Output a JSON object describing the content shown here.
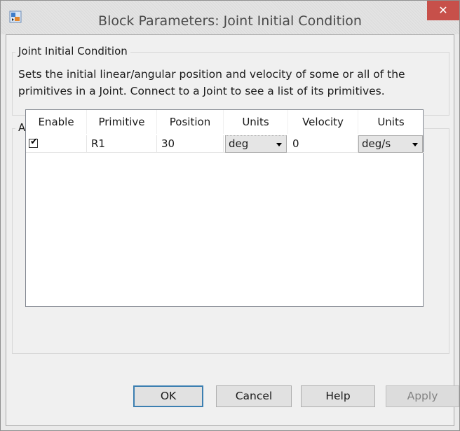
{
  "window": {
    "title": "Block Parameters: Joint Initial Condition",
    "close_symbol": "✕",
    "app_icon": "simulink-block-icon",
    "close_color": "#c7504a"
  },
  "block_group": {
    "legend": "Joint Initial Condition",
    "description_line1": "Sets the initial linear/angular position and velocity of some or all of the",
    "description_line2": "primitives in a Joint. Connect to a Joint to see a list of its primitives."
  },
  "actuation_group": {
    "legend": "Actuation",
    "table": {
      "headers": [
        "Enable",
        "Primitive",
        "Position",
        "Units",
        "Velocity",
        "Units"
      ],
      "rows": [
        {
          "enabled": true,
          "check_glyph": "✔",
          "primitive": "R1",
          "position": "30",
          "position_units": "deg",
          "velocity": "0",
          "velocity_units": "deg/s"
        }
      ]
    }
  },
  "buttons": {
    "ok": "OK",
    "cancel": "Cancel",
    "help": "Help",
    "apply": "Apply"
  }
}
